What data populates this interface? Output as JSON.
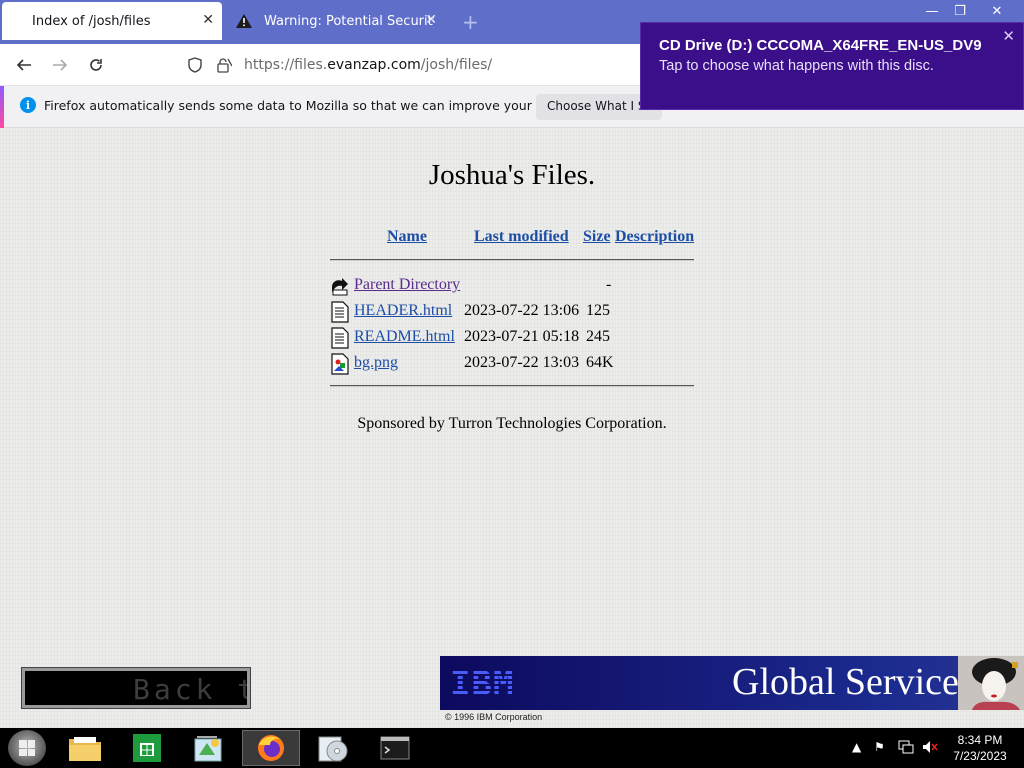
{
  "browser": {
    "tabs": [
      {
        "title": "Index of /josh/files",
        "active": true
      },
      {
        "title": "Warning: Potential Security Risk",
        "active": false
      }
    ],
    "new_tab_icon": "plus-icon",
    "url_scheme": "https://files.",
    "url_domain": "evanzap.com",
    "url_path": "/josh/files/",
    "window_controls": {
      "minimize": "—",
      "restore": "❐",
      "close": "✕"
    }
  },
  "notification": {
    "message": "Firefox automatically sends some data to Mozilla so that we can improve your experience.",
    "button": "Choose What I Share"
  },
  "toast": {
    "title": "CD Drive (D:) CCCOMA_X64FRE_EN-US_DV9",
    "message": "Tap to choose what happens with this disc."
  },
  "page": {
    "heading": "Joshua's Files.",
    "columns": {
      "name": "Name",
      "last_modified": "Last modified",
      "size": "Size",
      "description": "Description"
    },
    "rows": [
      {
        "name": "Parent Directory",
        "date": "",
        "size": "-",
        "icon": "back-folder-icon"
      },
      {
        "name": "HEADER.html",
        "date": "2023-07-22 13:06",
        "size": "125",
        "icon": "text-file-icon"
      },
      {
        "name": "README.html",
        "date": "2023-07-21 05:18",
        "size": "245",
        "icon": "text-file-icon"
      },
      {
        "name": "bg.png",
        "date": "2023-07-22 13:03",
        "size": "64K",
        "icon": "image-file-icon"
      }
    ],
    "sponsor": "Sponsored by Turron Technologies Corporation.",
    "marquee": "Back t",
    "banner": {
      "logo": "IBM",
      "text": "Global Services",
      "copyright": "© 1996 IBM Corporation"
    }
  },
  "taskbar": {
    "apps": [
      "file-explorer-icon",
      "store-icon",
      "control-panel-icon",
      "firefox-icon",
      "disc-burner-icon",
      "terminal-icon"
    ],
    "time": "8:34 PM",
    "date": "7/23/2023"
  }
}
